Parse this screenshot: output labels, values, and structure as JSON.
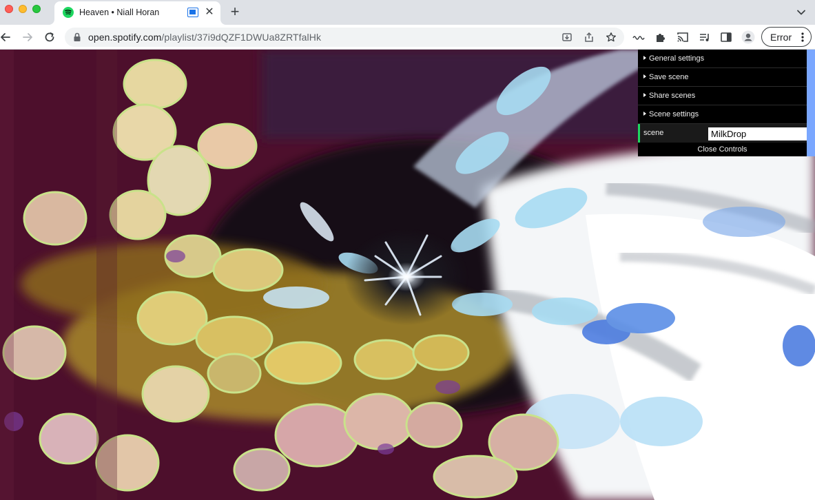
{
  "window": {
    "traffic_lights": [
      "close",
      "minimize",
      "zoom"
    ]
  },
  "tab": {
    "title": "Heaven • Niall Horan",
    "favicon": "spotify-icon",
    "close_glyph": "✕"
  },
  "toolbar": {
    "url_host": "open.spotify.com",
    "url_path": "/playlist/37i9dQZF1DWUa8ZRTfalHk",
    "profile_status": "Error"
  },
  "controls": {
    "folders": [
      {
        "label": "General settings"
      },
      {
        "label": "Save scene"
      },
      {
        "label": "Share scenes"
      },
      {
        "label": "Scene settings"
      }
    ],
    "scene_label": "scene",
    "scene_value": "MilkDrop",
    "close_label": "Close Controls"
  },
  "colors": {
    "accent_green": "#1ed760",
    "tabstrip_bg": "#dee1e6",
    "viz_bg": "#4a0f2a"
  }
}
